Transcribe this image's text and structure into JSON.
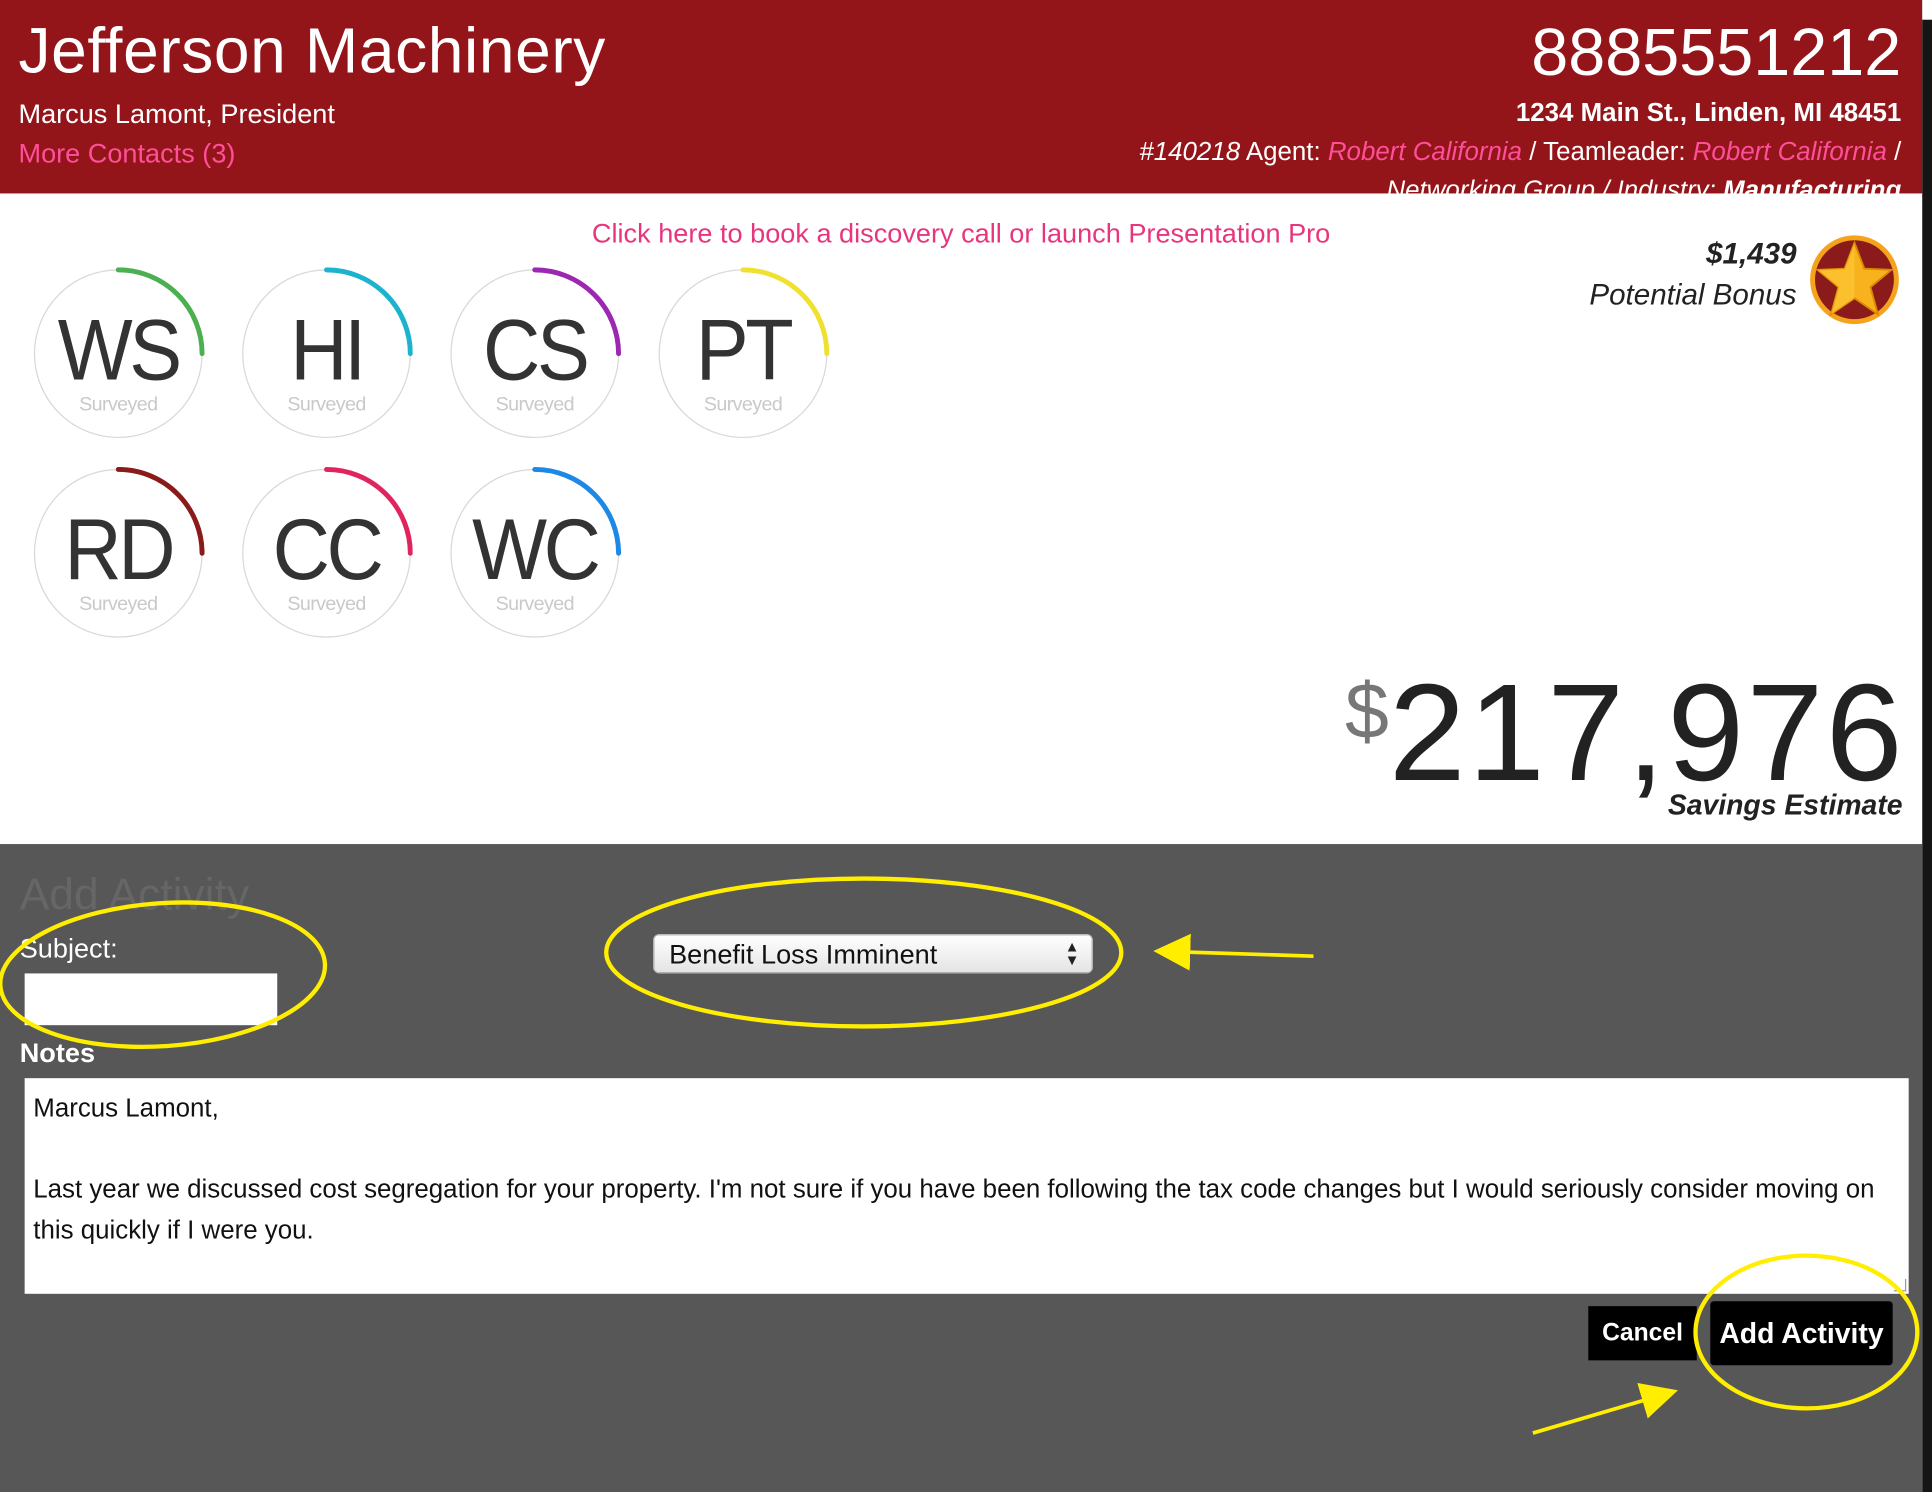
{
  "header": {
    "company": "Jefferson Machinery",
    "contact": "Marcus Lamont, President",
    "more_contacts": "More Contacts (3)",
    "phone": "8885551212",
    "address": "1234 Main St., Linden, MI 48451",
    "account_number": "#140218",
    "agent_label": " Agent: ",
    "agent_name": "Robert California",
    "teamleader_label": " / Teamleader: ",
    "teamleader_name": "Robert California",
    "trailing_slash": " /",
    "group_text": "Networking Group / Industry: ",
    "industry": "Manufacturing"
  },
  "book_link": "Click here to book a discovery call or launch Presentation Pro",
  "bonus": {
    "amount": "$1,439",
    "label": "Potential Bonus",
    "icon": "star-badge-icon",
    "badge_color": "#f4a31b"
  },
  "gauges": [
    {
      "abbr": "WS",
      "label": "Surveyed",
      "color": "#4caf50"
    },
    {
      "abbr": "HI",
      "label": "Surveyed",
      "color": "#1cb3cf"
    },
    {
      "abbr": "CS",
      "label": "Surveyed",
      "color": "#9c27b0"
    },
    {
      "abbr": "PT",
      "label": "Surveyed",
      "color": "#f0e130"
    },
    {
      "abbr": "RD",
      "label": "Surveyed",
      "color": "#8b1a1a"
    },
    {
      "abbr": "CC",
      "label": "Surveyed",
      "color": "#e0245e"
    },
    {
      "abbr": "WC",
      "label": "Surveyed",
      "color": "#1e88e5"
    }
  ],
  "savings": {
    "currency": "$",
    "amount": "217,976",
    "label": "Savings Estimate"
  },
  "activity": {
    "title": "Add Activity",
    "subject_label": "Subject:",
    "subject_value": "",
    "select_value": "Benefit Loss Imminent",
    "notes_label": "Notes",
    "notes_line1": "Marcus Lamont,",
    "notes_line2": "Last year we discussed cost segregation for your property.  I'm not sure if you have been following the tax code changes but I would seriously consider moving on this quickly if I were you.",
    "cancel_label": "Cancel",
    "add_label": "Add Activity"
  },
  "colors": {
    "header_bg": "#941519",
    "link_pink": "#ff4f9a",
    "panel_bg": "#575757",
    "annotation_yellow": "#ffee00"
  }
}
